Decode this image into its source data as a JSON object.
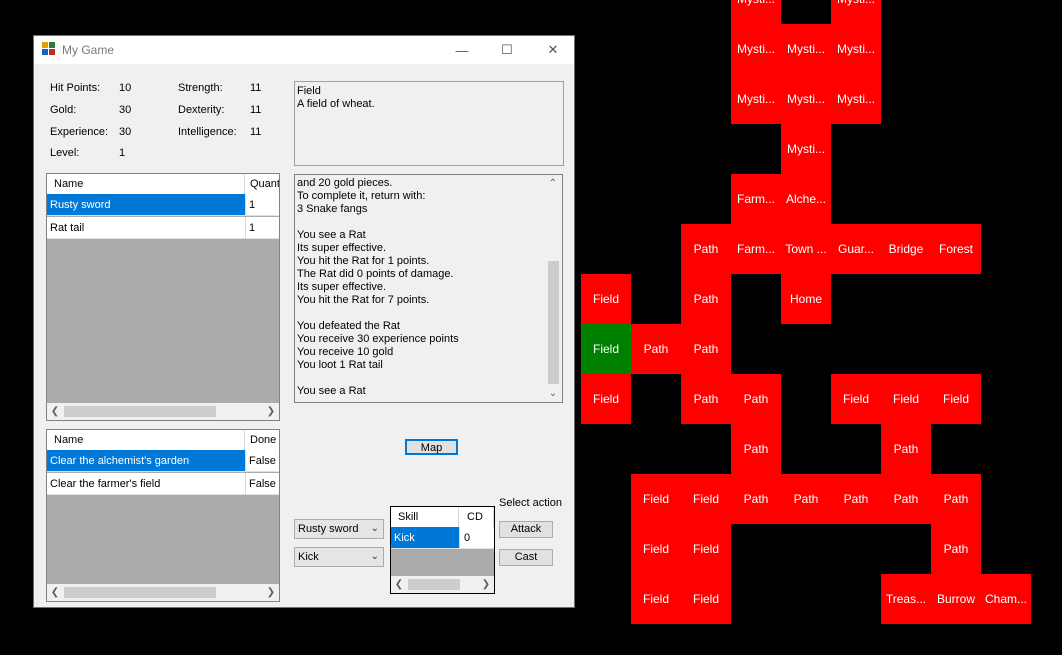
{
  "window": {
    "title": "My Game",
    "minimize": "—",
    "maximize": "☐",
    "close": "✕"
  },
  "stats": {
    "hp_label": "Hit Points:",
    "hp": "10",
    "gold_label": "Gold:",
    "gold": "30",
    "xp_label": "Experience:",
    "xp": "30",
    "level_label": "Level:",
    "level": "1",
    "str_label": "Strength:",
    "str": "11",
    "dex_label": "Dexterity:",
    "dex": "11",
    "int_label": "Intelligence:",
    "int": "11"
  },
  "location": {
    "name": "Field",
    "description": "A field of wheat."
  },
  "inventory": {
    "col_name": "Name",
    "col_qty": "Quant",
    "rows": [
      {
        "name": "Rusty sword",
        "qty": "1"
      },
      {
        "name": "Rat tail",
        "qty": "1"
      }
    ]
  },
  "quests": {
    "col_name": "Name",
    "col_done": "Done",
    "rows": [
      {
        "name": "Clear the alchemist's garden",
        "done": "False"
      },
      {
        "name": "Clear the farmer's field",
        "done": "False"
      }
    ]
  },
  "log": [
    "and 20 gold pieces.",
    "To complete it, return with:",
    "3 Snake fangs",
    "",
    "You see a Rat",
    "Its super effective.",
    "You hit the Rat for 1 points.",
    "The Rat did 0 points of damage.",
    "Its super effective.",
    "You hit the Rat for 7 points.",
    "",
    "You defeated the Rat",
    "You receive 30 experience points",
    "You receive 10 gold",
    "You loot 1 Rat tail",
    "",
    "You see a Rat"
  ],
  "controls": {
    "map_button": "Map",
    "weapon_select": "Rusty sword",
    "skill_select": "Kick",
    "select_action": "Select action",
    "attack_button": "Attack",
    "cast_button": "Cast"
  },
  "skills": {
    "col_skill": "Skill",
    "col_cd": "CD",
    "rows": [
      {
        "skill": "Kick",
        "cd": "0"
      }
    ]
  },
  "map_tiles": [
    {
      "label": "Mysti...",
      "col": 3,
      "row": -1
    },
    {
      "label": "Mysti...",
      "col": 5,
      "row": -1
    },
    {
      "label": "Mysti...",
      "col": 3,
      "row": 0
    },
    {
      "label": "Mysti...",
      "col": 4,
      "row": 0
    },
    {
      "label": "Mysti...",
      "col": 5,
      "row": 0
    },
    {
      "label": "Mysti...",
      "col": 3,
      "row": 1
    },
    {
      "label": "Mysti...",
      "col": 4,
      "row": 1
    },
    {
      "label": "Mysti...",
      "col": 5,
      "row": 1
    },
    {
      "label": "Mysti...",
      "col": 4,
      "row": 2
    },
    {
      "label": "Farm...",
      "col": 3,
      "row": 3
    },
    {
      "label": "Alche...",
      "col": 4,
      "row": 3
    },
    {
      "label": "Path",
      "col": 2,
      "row": 4
    },
    {
      "label": "Farm...",
      "col": 3,
      "row": 4
    },
    {
      "label": "Town ...",
      "col": 4,
      "row": 4
    },
    {
      "label": "Guar...",
      "col": 5,
      "row": 4
    },
    {
      "label": "Bridge",
      "col": 6,
      "row": 4
    },
    {
      "label": "Forest",
      "col": 7,
      "row": 4
    },
    {
      "label": "Field",
      "col": 0,
      "row": 5
    },
    {
      "label": "Path",
      "col": 2,
      "row": 5
    },
    {
      "label": "Home",
      "col": 4,
      "row": 5
    },
    {
      "label": "Field",
      "col": 0,
      "row": 6,
      "current": true
    },
    {
      "label": "Path",
      "col": 1,
      "row": 6
    },
    {
      "label": "Path",
      "col": 2,
      "row": 6
    },
    {
      "label": "Field",
      "col": 0,
      "row": 7
    },
    {
      "label": "Path",
      "col": 2,
      "row": 7
    },
    {
      "label": "Path",
      "col": 3,
      "row": 7
    },
    {
      "label": "Field",
      "col": 5,
      "row": 7
    },
    {
      "label": "Field",
      "col": 6,
      "row": 7
    },
    {
      "label": "Field",
      "col": 7,
      "row": 7
    },
    {
      "label": "Path",
      "col": 3,
      "row": 8
    },
    {
      "label": "Path",
      "col": 6,
      "row": 8
    },
    {
      "label": "Field",
      "col": 1,
      "row": 9
    },
    {
      "label": "Field",
      "col": 2,
      "row": 9
    },
    {
      "label": "Path",
      "col": 3,
      "row": 9
    },
    {
      "label": "Path",
      "col": 4,
      "row": 9
    },
    {
      "label": "Path",
      "col": 5,
      "row": 9
    },
    {
      "label": "Path",
      "col": 6,
      "row": 9
    },
    {
      "label": "Path",
      "col": 7,
      "row": 9
    },
    {
      "label": "Field",
      "col": 1,
      "row": 10
    },
    {
      "label": "Field",
      "col": 2,
      "row": 10
    },
    {
      "label": "Path",
      "col": 7,
      "row": 10
    },
    {
      "label": "Field",
      "col": 1,
      "row": 11
    },
    {
      "label": "Field",
      "col": 2,
      "row": 11
    },
    {
      "label": "Treas...",
      "col": 6,
      "row": 11
    },
    {
      "label": "Burrow",
      "col": 7,
      "row": 11
    },
    {
      "label": "Cham...",
      "col": 8,
      "row": 11
    }
  ],
  "colors": {
    "tile": "#ff0000",
    "current_tile": "#008000",
    "selection": "#0078d7"
  }
}
